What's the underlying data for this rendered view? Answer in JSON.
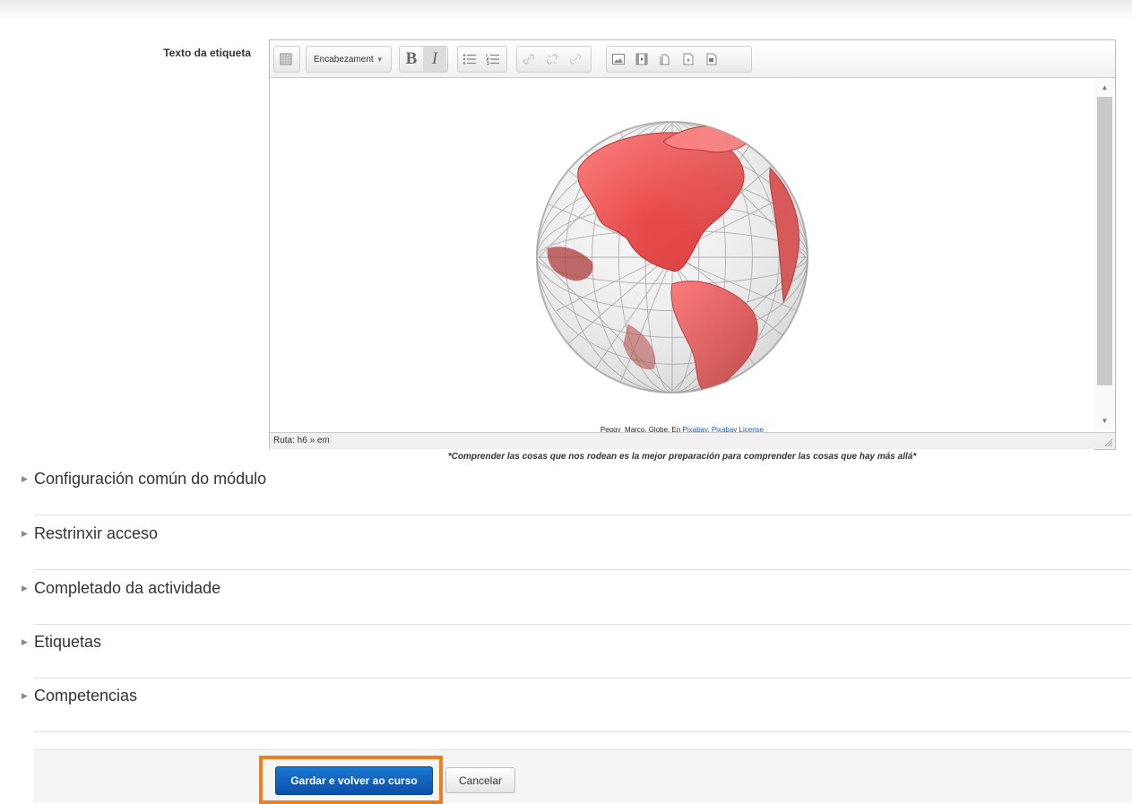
{
  "form": {
    "field_label": "Texto da etiqueta"
  },
  "editor": {
    "toolbar": {
      "format_select": "Encabezament",
      "bold": "B",
      "italic": "I"
    },
    "content": {
      "image_alt": "globe",
      "credit_prefix": "Peggy_Marco. Globe. En ",
      "credit_link1": "Pixabay",
      "credit_sep": ". ",
      "credit_link2": "Pixabay License",
      "quote": "*Comprender las cosas que nos rodean es la mejor preparación para comprender las cosas que hay más allá*"
    },
    "status_path": "Ruta: h6 » em"
  },
  "sections": [
    {
      "title": "Configuración común do módulo"
    },
    {
      "title": "Restrinxir acceso"
    },
    {
      "title": "Completado da actividade"
    },
    {
      "title": "Etiquetas"
    },
    {
      "title": "Competencias"
    }
  ],
  "footer": {
    "save_label": "Gardar e volver ao curso",
    "cancel_label": "Cancelar"
  },
  "colors": {
    "primary_button": "#0b4fa8",
    "highlight": "#f07f1a",
    "continent": "#e8403f"
  }
}
